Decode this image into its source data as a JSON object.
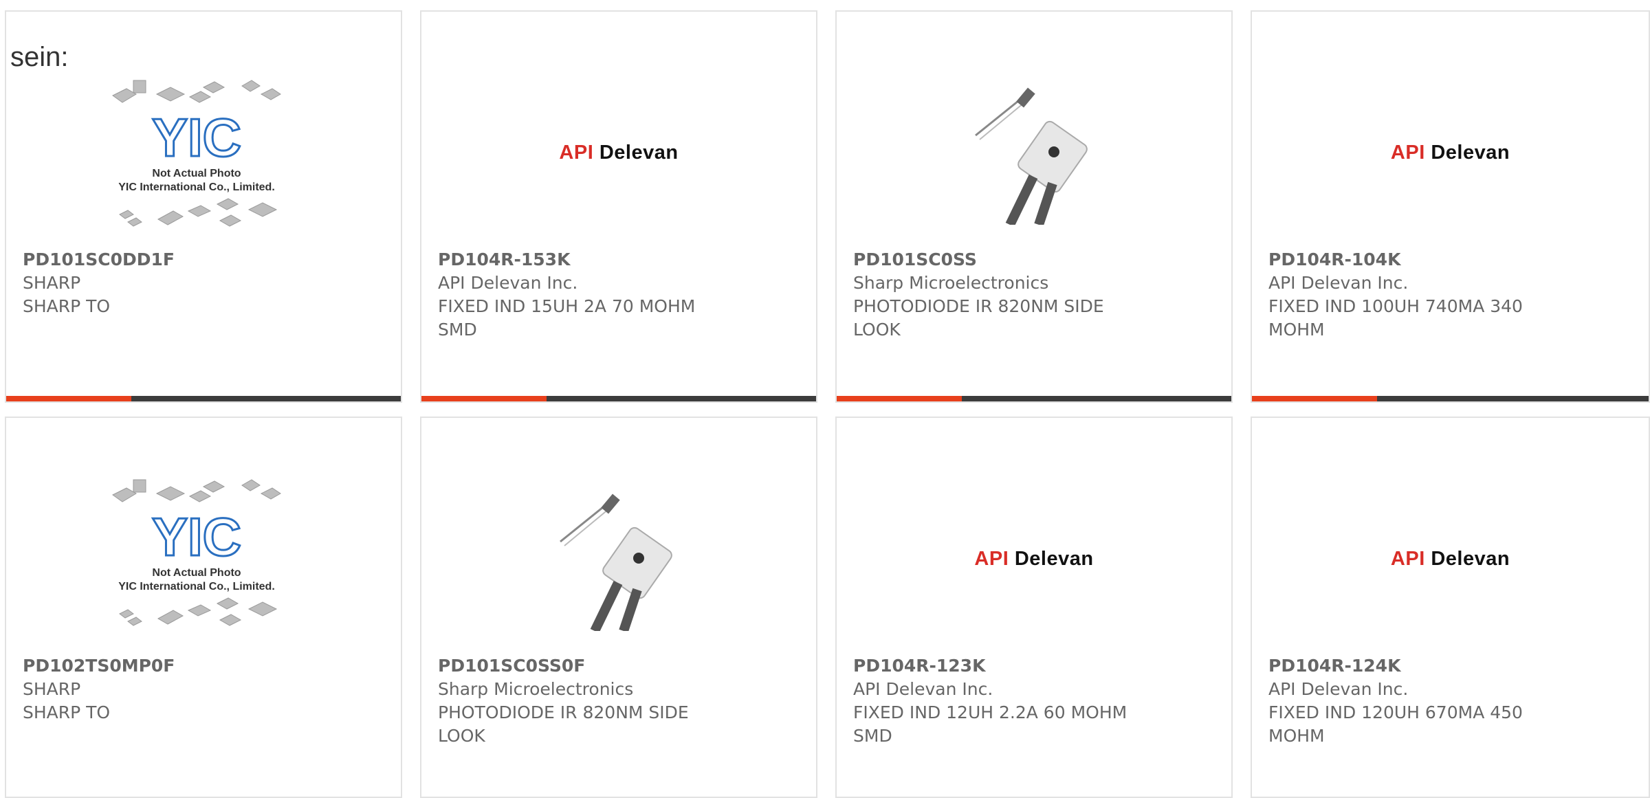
{
  "intro_text": "sein:",
  "colors": {
    "accent": "#e8401c",
    "bar": "#3c3c3c",
    "text": "#666666",
    "api_red": "#d92d27",
    "yic_blue": "#2a6fc0"
  },
  "yic_placeholder": {
    "logo": "YIC",
    "line1": "Not Actual Photo",
    "line2": "YIC International Co., Limited."
  },
  "api_logo": {
    "part1": "API",
    "part2": "Delevan"
  },
  "products": [
    {
      "part_number": "PD101SC0DD1F",
      "manufacturer": "SHARP",
      "description": "SHARP TO",
      "image": "yic-placeholder"
    },
    {
      "part_number": "PD104R-153K",
      "manufacturer": "API Delevan Inc.",
      "description": "FIXED IND 15UH 2A 70 MOHM SMD",
      "image": "api-delevan-logo"
    },
    {
      "part_number": "PD101SC0SS",
      "manufacturer": "Sharp Microelectronics",
      "description": "PHOTODIODE IR 820NM SIDE LOOK",
      "image": "photodiode-photo"
    },
    {
      "part_number": "PD104R-104K",
      "manufacturer": "API Delevan Inc.",
      "description": "FIXED IND 100UH 740MA 340 MOHM",
      "image": "api-delevan-logo"
    },
    {
      "part_number": "PD102TS0MP0F",
      "manufacturer": "SHARP",
      "description": "SHARP TO",
      "image": "yic-placeholder"
    },
    {
      "part_number": "PD101SC0SS0F",
      "manufacturer": "Sharp Microelectronics",
      "description": "PHOTODIODE IR 820NM SIDE LOOK",
      "image": "photodiode-photo"
    },
    {
      "part_number": "PD104R-123K",
      "manufacturer": "API Delevan Inc.",
      "description": "FIXED IND 12UH 2.2A 60 MOHM SMD",
      "image": "api-delevan-logo"
    },
    {
      "part_number": "PD104R-124K",
      "manufacturer": "API Delevan Inc.",
      "description": "FIXED IND 120UH 670MA 450 MOHM",
      "image": "api-delevan-logo"
    }
  ]
}
